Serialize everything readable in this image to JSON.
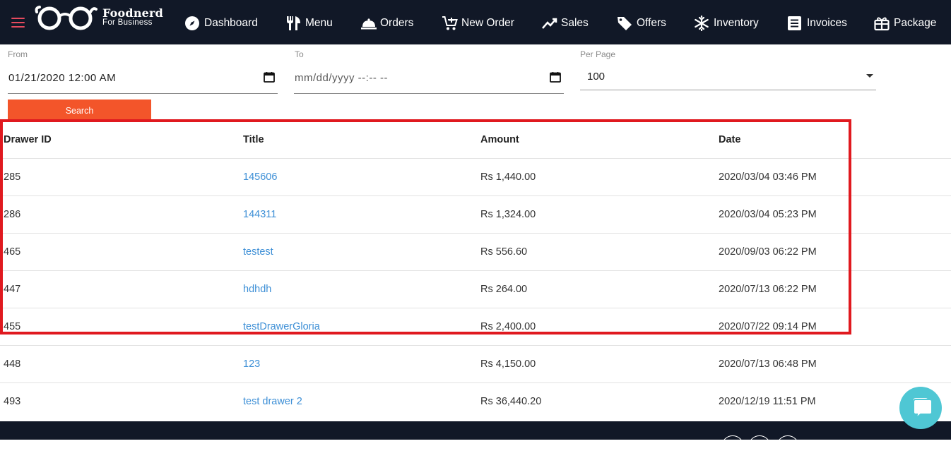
{
  "brand": {
    "name": "Foodnerd",
    "tagline": "For Business"
  },
  "nav": [
    {
      "label": "Dashboard",
      "icon": "compass-icon"
    },
    {
      "label": "Menu",
      "icon": "fork-knife-icon"
    },
    {
      "label": "Orders",
      "icon": "cloche-icon"
    },
    {
      "label": "New Order",
      "icon": "cart-plus-icon"
    },
    {
      "label": "Sales",
      "icon": "trend-line-icon"
    },
    {
      "label": "Offers",
      "icon": "tag-icon"
    },
    {
      "label": "Inventory",
      "icon": "snowflake-icon"
    },
    {
      "label": "Invoices",
      "icon": "document-list-icon"
    },
    {
      "label": "Package",
      "icon": "gift-box-icon"
    }
  ],
  "filters": {
    "from_label": "From",
    "from_value": "01/21/2020 12:00 AM",
    "to_label": "To",
    "to_placeholder": "mm/dd/yyyy --:-- --",
    "per_page_label": "Per Page",
    "per_page_value": "100",
    "search_label": "Search"
  },
  "table": {
    "columns": [
      "Drawer ID",
      "Title",
      "Amount",
      "Date"
    ],
    "rows": [
      {
        "id": "285",
        "title": "145606",
        "amount": "Rs 1,440.00",
        "date": "2020/03/04 03:46 PM"
      },
      {
        "id": "286",
        "title": "144311",
        "amount": "Rs 1,324.00",
        "date": "2020/03/04 05:23 PM"
      },
      {
        "id": "465",
        "title": "testest",
        "amount": "Rs 556.60",
        "date": "2020/09/03 06:22 PM"
      },
      {
        "id": "447",
        "title": "hdhdh",
        "amount": "Rs 264.00",
        "date": "2020/07/13 06:22 PM"
      },
      {
        "id": "455",
        "title": "testDrawerGloria",
        "amount": "Rs 2,400.00",
        "date": "2020/07/22 09:14 PM"
      },
      {
        "id": "448",
        "title": "123",
        "amount": "Rs 4,150.00",
        "date": "2020/07/13 06:48 PM"
      },
      {
        "id": "493",
        "title": "test drawer 2",
        "amount": "Rs 36,440.20",
        "date": "2020/12/19 11:51 PM"
      }
    ]
  },
  "colors": {
    "navbar": "#111827",
    "accent": "#f3552a",
    "link": "#3d8fd6",
    "highlight": "#e0191f",
    "chat": "#4fc7d4",
    "hamburger": "#e64a5e"
  }
}
